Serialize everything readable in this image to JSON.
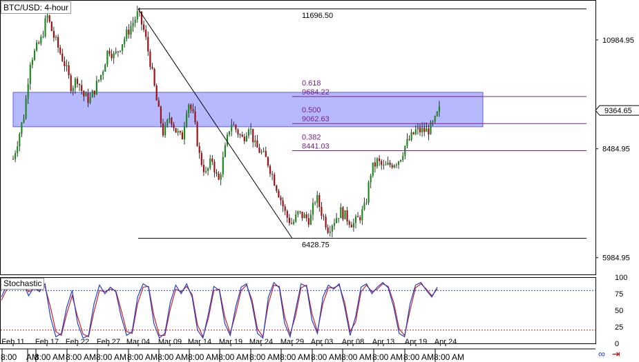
{
  "header": {
    "title": "BTC/USD: 4-hour"
  },
  "stochastic": {
    "label": "Stochastic",
    "levels": [
      "100",
      "75",
      "50",
      "25",
      "0"
    ]
  },
  "nav": {
    "link_icon": "link-icon",
    "arrow_icon": "arrow-back-icon"
  },
  "colors": {
    "up_candle": "#1e8a1e",
    "down_candle": "#a01010",
    "fib_line": "#7a1f8a",
    "zone_fill": "#7b80ff",
    "stoch_k": "#1d3fcf",
    "stoch_d": "#cc2020",
    "upper_level": "#1d3fcf",
    "lower_level": "#cc2020"
  },
  "chart_data": {
    "type": "candlestick",
    "title": "BTC/USD: 4-hour",
    "price_axis": {
      "ylim": [
        5600,
        11900
      ],
      "tick_labels": [
        "10984.95",
        "8484.95",
        "5984.95"
      ]
    },
    "current_price": "9364.65",
    "date_labels": [
      "Feb 11",
      "Feb 17",
      "Feb 22",
      "Feb 27",
      "Mar 04",
      "Mar 09",
      "Mar 14",
      "Mar 19",
      "Mar 24",
      "Mar 29",
      "Apr 03",
      "Apr 08",
      "Apr 13",
      "Apr 19",
      "Apr 24"
    ],
    "time_labels": [
      "8:00",
      "AM",
      "8:00 AM",
      "8:00 AM",
      "8:00 AM",
      "8:00 AM",
      "8:00 AM",
      "8:00 AM",
      "8:00 AM",
      "8:00 AM",
      "8:00 AM",
      "8:00 AM",
      "8:00 AM",
      "8:00 AM",
      "8:00 AM",
      "8:00 AM"
    ],
    "swing_high": {
      "label": "11696.50",
      "value": 11696.5,
      "date": "Mar 04"
    },
    "swing_low": {
      "label": "6428.75",
      "value": 6428.75,
      "date": "Mar 29"
    },
    "fib_levels": [
      {
        "ratio": "0.618",
        "price": "9684.22",
        "value": 9684.22
      },
      {
        "ratio": "0.500",
        "price": "9062.63",
        "value": 9062.63
      },
      {
        "ratio": "0.382",
        "price": "8441.03",
        "value": 8441.03
      }
    ],
    "zone": {
      "from": 8990,
      "to": 9780,
      "start": "Feb 11",
      "end": "Apr 24"
    },
    "path": [
      [
        "Feb 11",
        8250
      ],
      [
        "Feb 13",
        9300
      ],
      [
        "Feb 14",
        10500
      ],
      [
        "Feb 16",
        11000
      ],
      [
        "Feb 17",
        11550
      ],
      [
        "Feb 18",
        11100
      ],
      [
        "Feb 20",
        10400
      ],
      [
        "Feb 21",
        9900
      ],
      [
        "Feb 22",
        10100
      ],
      [
        "Feb 23",
        9700
      ],
      [
        "Feb 24",
        9600
      ],
      [
        "Feb 26",
        10250
      ],
      [
        "Feb 27",
        10800
      ],
      [
        "Feb 28",
        10600
      ],
      [
        "Mar 02",
        11100
      ],
      [
        "Mar 04",
        11600
      ],
      [
        "Mar 05",
        11150
      ],
      [
        "Mar 06",
        10400
      ],
      [
        "Mar 07",
        9500
      ],
      [
        "Mar 08",
        8800
      ],
      [
        "Mar 09",
        9250
      ],
      [
        "Mar 10",
        8900
      ],
      [
        "Mar 11",
        8700
      ],
      [
        "Mar 12",
        9600
      ],
      [
        "Mar 13",
        9200
      ],
      [
        "Mar 14",
        8300
      ],
      [
        "Mar 15",
        7900
      ],
      [
        "Mar 16",
        8250
      ],
      [
        "Mar 17",
        7700
      ],
      [
        "Mar 18",
        8400
      ],
      [
        "Mar 19",
        9100
      ],
      [
        "Mar 20",
        8900
      ],
      [
        "Mar 21",
        8700
      ],
      [
        "Mar 22",
        9050
      ],
      [
        "Mar 23",
        8550
      ],
      [
        "Mar 24",
        8400
      ],
      [
        "Mar 25",
        8200
      ],
      [
        "Mar 26",
        7800
      ],
      [
        "Mar 27",
        7400
      ],
      [
        "Mar 28",
        6950
      ],
      [
        "Mar 29",
        6750
      ],
      [
        "Mar 30",
        7000
      ],
      [
        "Apr 01",
        6850
      ],
      [
        "Apr 02",
        7400
      ],
      [
        "Apr 03",
        7000
      ],
      [
        "Apr 04",
        6650
      ],
      [
        "Apr 05",
        6850
      ],
      [
        "Apr 06",
        7050
      ],
      [
        "Apr 08",
        6750
      ],
      [
        "Apr 09",
        6900
      ],
      [
        "Apr 10",
        7150
      ],
      [
        "Apr 11",
        8000
      ],
      [
        "Apr 12",
        8200
      ],
      [
        "Apr 13",
        8050
      ],
      [
        "Apr 14",
        8100
      ],
      [
        "Apr 16",
        8250
      ],
      [
        "Apr 17",
        8550
      ],
      [
        "Apr 19",
        8900
      ],
      [
        "Apr 21",
        8900
      ],
      [
        "Apr 22",
        9050
      ],
      [
        "Apr 23",
        9400
      ]
    ],
    "stochastic_levels": {
      "upper": 80,
      "lower": 20
    },
    "stochastic_k": [
      70,
      88,
      82,
      90,
      92,
      72,
      85,
      78,
      90,
      40,
      10,
      15,
      55,
      80,
      30,
      8,
      12,
      60,
      88,
      75,
      85,
      78,
      40,
      12,
      18,
      70,
      90,
      85,
      30,
      8,
      15,
      62,
      88,
      75,
      90,
      70,
      20,
      8,
      45,
      86,
      80,
      30,
      12,
      55,
      85,
      90,
      60,
      15,
      8,
      70,
      92,
      84,
      30,
      10,
      50,
      90,
      86,
      35,
      15,
      70,
      88,
      82,
      90,
      55,
      12,
      40,
      85,
      90,
      75,
      85,
      92,
      84,
      55,
      15,
      10,
      60,
      88,
      92,
      80,
      70,
      85
    ],
    "stochastic_d": [
      65,
      82,
      85,
      88,
      90,
      78,
      82,
      80,
      86,
      55,
      18,
      12,
      45,
      72,
      40,
      14,
      10,
      48,
      80,
      78,
      82,
      80,
      50,
      18,
      15,
      60,
      85,
      86,
      42,
      12,
      12,
      52,
      82,
      78,
      86,
      74,
      28,
      10,
      38,
      80,
      82,
      40,
      15,
      45,
      80,
      88,
      66,
      22,
      10,
      60,
      88,
      86,
      40,
      14,
      42,
      84,
      88,
      45,
      18,
      60,
      84,
      84,
      88,
      62,
      18,
      32,
      78,
      88,
      78,
      82,
      90,
      86,
      62,
      22,
      12,
      50,
      84,
      90,
      82,
      72,
      82
    ]
  }
}
